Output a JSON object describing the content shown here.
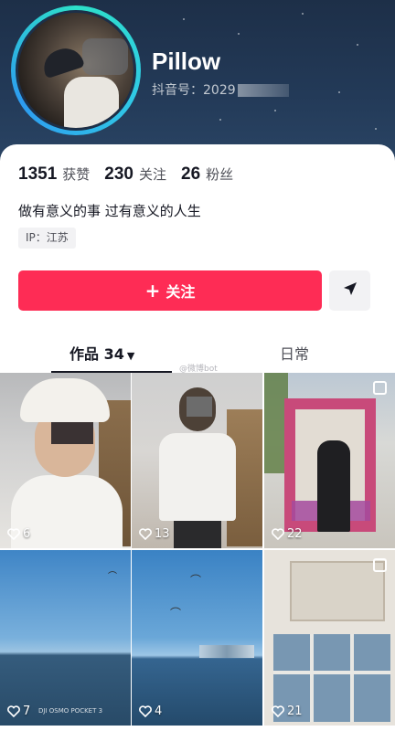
{
  "profile": {
    "nickname": "Pillow",
    "douyin_id_label": "抖音号：",
    "douyin_id_visible": "2029",
    "stats": [
      {
        "value": "1351",
        "label": "获赞"
      },
      {
        "value": "230",
        "label": "关注"
      },
      {
        "value": "26",
        "label": "粉丝"
      }
    ],
    "bio": "做有意义的事 过有意义的人生",
    "ip": "IP：江苏"
  },
  "actions": {
    "follow_plus": "+",
    "follow_label": "关注",
    "share_icon": "send-icon"
  },
  "tabs": {
    "works": "作品 34",
    "works_caret": "▼",
    "daily": "日常"
  },
  "watermark": "@微博bot",
  "tiles": [
    {
      "likes": "6"
    },
    {
      "likes": "13"
    },
    {
      "likes": "22",
      "multi": true
    },
    {
      "likes": "7",
      "overlay_text": "DJI OSMO POCKET 3"
    },
    {
      "likes": "4"
    },
    {
      "likes": "21",
      "multi": true
    }
  ],
  "colors": {
    "accent": "#fe2c55",
    "ring": "#2de0c9",
    "header_bg": "#233a58"
  }
}
